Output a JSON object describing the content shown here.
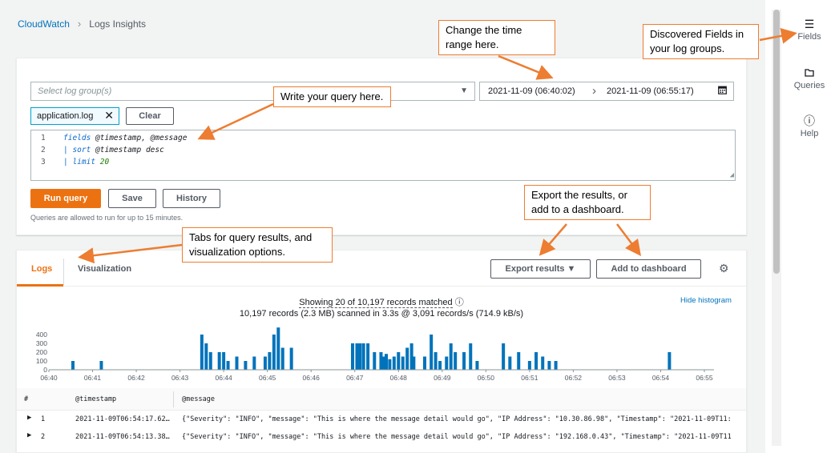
{
  "breadcrumb": {
    "root": "CloudWatch",
    "separator": "›",
    "current": "Logs Insights"
  },
  "right_rail": [
    {
      "icon": "☰",
      "label": "Fields"
    },
    {
      "icon": "🗀",
      "label": "Queries"
    },
    {
      "icon": "ⓘ",
      "label": "Help"
    }
  ],
  "query": {
    "log_group_placeholder": "Select log group(s)",
    "time_start": "2021-11-09 (06:40:02)",
    "time_end": "2021-11-09 (06:55:17)",
    "selected_log_group": "application.log",
    "clear_label": "Clear",
    "lines": [
      {
        "n": "1",
        "kw": "fields",
        "rest": " @timestamp, @message"
      },
      {
        "n": "2",
        "kw": "| sort",
        "rest": " @timestamp desc"
      },
      {
        "n": "3",
        "kw": "| limit",
        "rest": " 20"
      }
    ],
    "run_label": "Run query",
    "save_label": "Save",
    "history_label": "History",
    "hint": "Queries are allowed to run for up to 15 minutes."
  },
  "results": {
    "tab_logs": "Logs",
    "tab_visualization": "Visualization",
    "export_label": "Export results ▼",
    "dashboard_label": "Add to dashboard",
    "summary_line1": "Showing 20 of 10,197 records matched",
    "summary_line2": "10,197 records (2.3 MB) scanned in 3.3s @ 3,091 records/s (714.9 kB/s)",
    "hide_histogram": "Hide histogram",
    "columns": [
      "#",
      "@timestamp",
      "@message"
    ],
    "rows": [
      {
        "idx": "1",
        "ts": "2021-11-09T06:54:17.62…",
        "msg": "{\"Severity\": \"INFO\", \"message\": \"This is where the message detail would go\", \"IP Address\": \"10.30.86.98\", \"Timestamp\": \"2021-11-09T11:"
      },
      {
        "idx": "2",
        "ts": "2021-11-09T06:54:13.38…",
        "msg": "{\"Severity\": \"INFO\", \"message\": \"This is where the message detail would go\", \"IP Address\": \"192.168.0.43\", \"Timestamp\": \"2021-11-09T11"
      }
    ]
  },
  "chart_data": {
    "type": "bar",
    "x_ticks": [
      "06:40",
      "06:41",
      "06:42",
      "06:43",
      "06:44",
      "06:45",
      "06:46",
      "06:47",
      "06:48",
      "06:49",
      "06:50",
      "06:51",
      "06:52",
      "06:53",
      "06:54",
      "06:55"
    ],
    "y_ticks": [
      "400",
      "300",
      "200",
      "100",
      "0"
    ],
    "ylim": [
      0,
      400
    ],
    "x_range_minutes": [
      0,
      15
    ],
    "bar_color": "#0073bb",
    "bars": [
      [
        0.55,
        100
      ],
      [
        1.2,
        100
      ],
      [
        3.5,
        400
      ],
      [
        3.6,
        300
      ],
      [
        3.7,
        200
      ],
      [
        3.9,
        200
      ],
      [
        4.0,
        200
      ],
      [
        4.1,
        100
      ],
      [
        4.3,
        150
      ],
      [
        4.5,
        100
      ],
      [
        4.7,
        150
      ],
      [
        4.95,
        150
      ],
      [
        5.05,
        200
      ],
      [
        5.15,
        400
      ],
      [
        5.25,
        500
      ],
      [
        5.35,
        250
      ],
      [
        5.55,
        250
      ],
      [
        6.95,
        300
      ],
      [
        7.05,
        300
      ],
      [
        7.12,
        300
      ],
      [
        7.2,
        300
      ],
      [
        7.3,
        300
      ],
      [
        7.45,
        200
      ],
      [
        7.6,
        200
      ],
      [
        7.65,
        150
      ],
      [
        7.72,
        180
      ],
      [
        7.8,
        120
      ],
      [
        7.9,
        150
      ],
      [
        8.0,
        200
      ],
      [
        8.1,
        150
      ],
      [
        8.2,
        250
      ],
      [
        8.3,
        300
      ],
      [
        8.35,
        150
      ],
      [
        8.6,
        150
      ],
      [
        8.75,
        400
      ],
      [
        8.85,
        200
      ],
      [
        8.95,
        100
      ],
      [
        9.1,
        150
      ],
      [
        9.2,
        300
      ],
      [
        9.3,
        200
      ],
      [
        9.5,
        200
      ],
      [
        9.65,
        300
      ],
      [
        9.8,
        100
      ],
      [
        10.4,
        300
      ],
      [
        10.55,
        150
      ],
      [
        10.75,
        200
      ],
      [
        11.0,
        100
      ],
      [
        11.15,
        200
      ],
      [
        11.3,
        150
      ],
      [
        11.45,
        100
      ],
      [
        11.6,
        100
      ],
      [
        14.2,
        200
      ]
    ]
  },
  "callouts": {
    "time": "Change the time range here.",
    "fields": "Discovered Fields in your log groups.",
    "query": "Write your query here.",
    "export": "Export the results, or add to a dashboard.",
    "tabs": "Tabs for query results, and visualization options."
  },
  "colors": {
    "accent": "#ec7211",
    "link": "#0073bb",
    "callout_border": "#ed7d31"
  }
}
